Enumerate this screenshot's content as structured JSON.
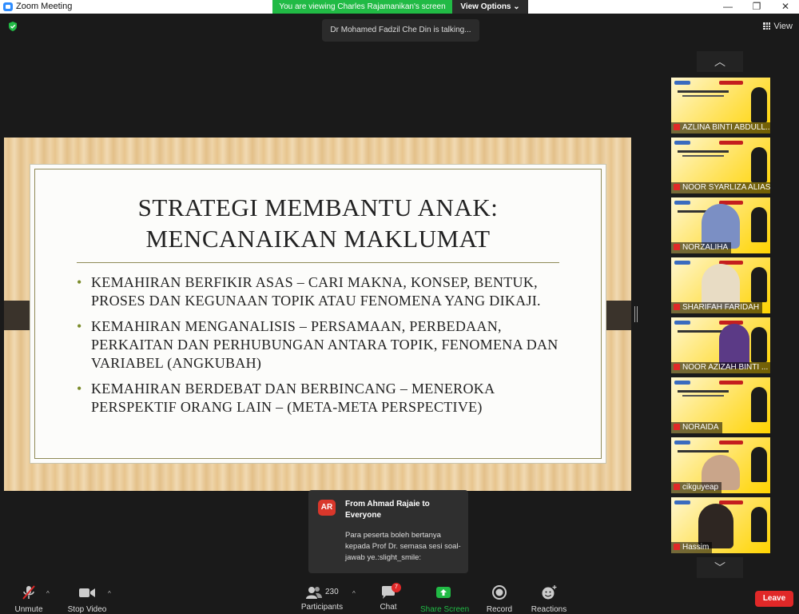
{
  "window": {
    "title": "Zoom Meeting"
  },
  "banner": {
    "viewing": "You are viewing Charles Rajamanikan's screen",
    "view_options": "View Options ⌄"
  },
  "talking": "Dr Mohamed Fadzil Che Din is talking...",
  "view_button": "View",
  "slide": {
    "title_line1": "STRATEGI MEMBANTU ANAK:",
    "title_line2": "MENCANAIKAN MAKLUMAT",
    "bullets": [
      "KEMAHIRAN BERFIKIR ASAS – CARI MAKNA, KONSEP, BENTUK, PROSES DAN KEGUNAAN TOPIK ATAU FENOMENA YANG DIKAJI.",
      "KEMAHIRAN MENGANALISIS – PERSAMAAN, PERBEDAAN, PERKAITAN DAN PERHUBUNGAN ANTARA TOPIK, FENOMENA DAN VARIABEL (ANGKUBAH)",
      "KEMAHIRAN BERDEBAT DAN BERBINCANG – MENEROKA PERSPEKTIF ORANG LAIN – (META-META PERSPECTIVE)"
    ]
  },
  "participants": [
    {
      "name": "AZLINA BINTI ABDULL...",
      "video": "poster"
    },
    {
      "name": "NOOR SYARLIZA ALIAS",
      "video": "poster"
    },
    {
      "name": "NORZALIHA",
      "video": "poster"
    },
    {
      "name": "SHARIFAH FARIDAH",
      "video": "poster"
    },
    {
      "name": "NOOR AZIZAH BINTI ...",
      "video": "poster"
    },
    {
      "name": "NORAIDA",
      "video": "poster"
    },
    {
      "name": "cikguyeap",
      "video": "poster"
    },
    {
      "name": "Hassim",
      "video": "poster"
    }
  ],
  "toast": {
    "initials": "AR",
    "from": "From Ahmad Rajaie to Everyone",
    "message": "Para peserta boleh bertanya kepada Prof Dr. semasa sesi soal-jawab ye.:slight_smile:"
  },
  "toolbar": {
    "unmute": "Unmute",
    "stop_video": "Stop Video",
    "participants": "Participants",
    "participant_count": "230",
    "chat": "Chat",
    "chat_badge": "7",
    "share_screen": "Share Screen",
    "record": "Record",
    "reactions": "Reactions",
    "leave": "Leave"
  },
  "colors": {
    "share_green": "#21ba45",
    "leave_red": "#e02828",
    "toolbar_bg": "#1a1a1a"
  }
}
